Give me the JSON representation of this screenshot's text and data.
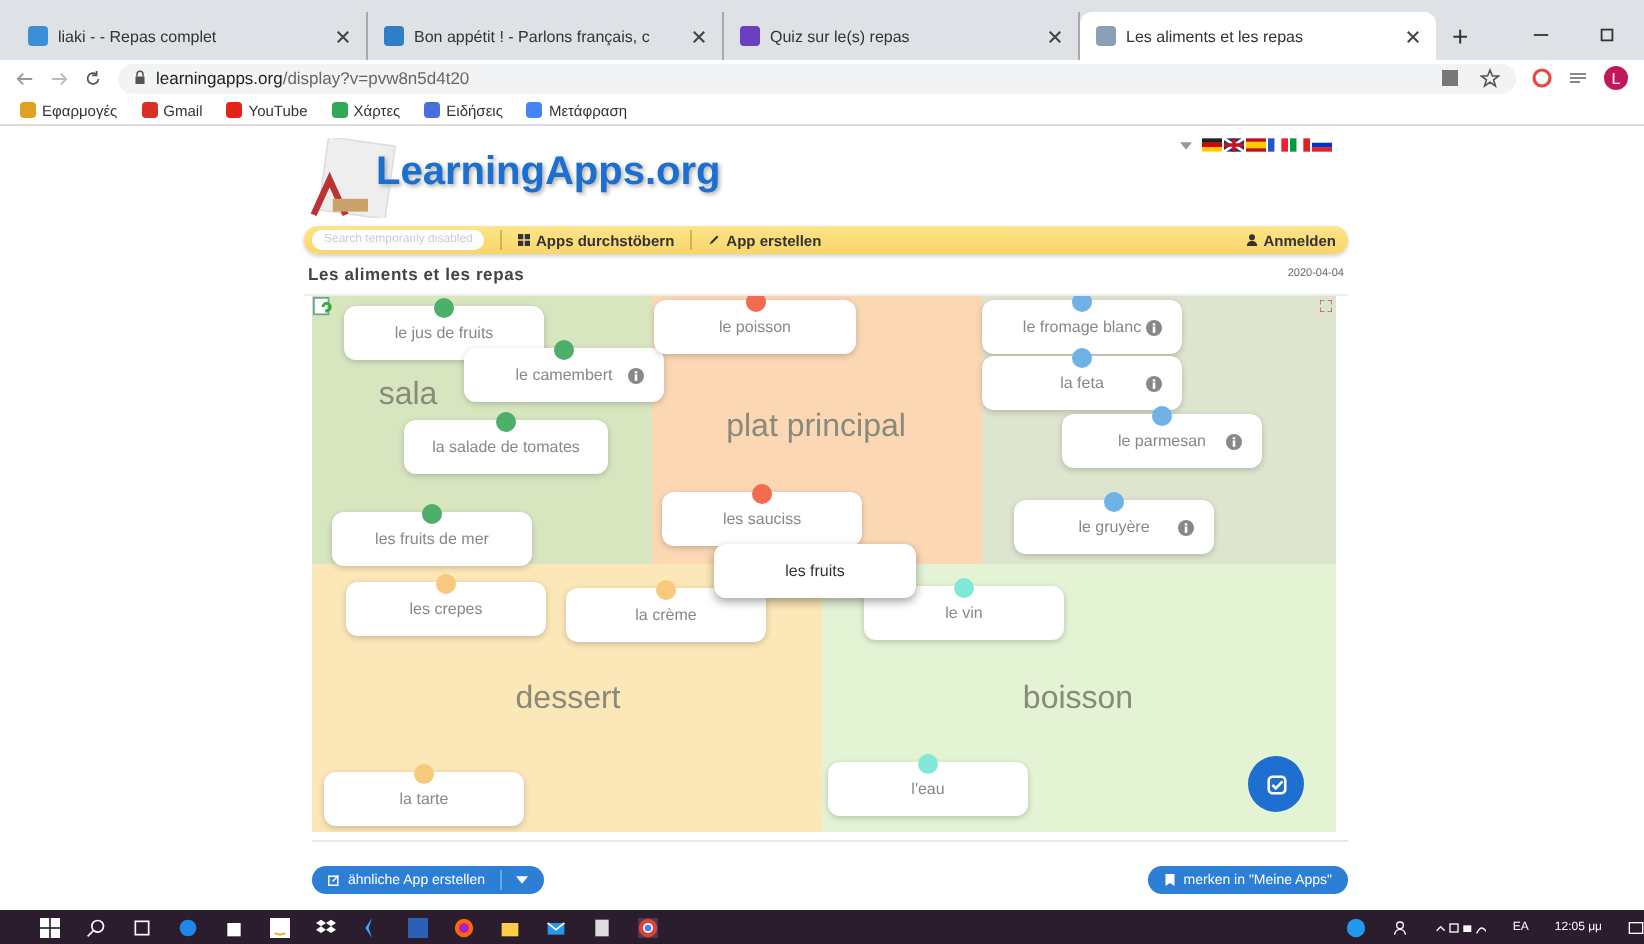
{
  "browser": {
    "tabs": [
      {
        "title": "liaki - - Repas complet",
        "selected": false,
        "color": "#3b8fd6"
      },
      {
        "title": "Bon appétit ! - Parlons français, c",
        "selected": false,
        "color": "#2f7fc8"
      },
      {
        "title": "Quiz sur le(s) repas",
        "selected": false,
        "color": "#6a3fbf"
      },
      {
        "title": "Les aliments et les repas",
        "selected": true,
        "color": "#8aa0b8"
      }
    ],
    "new_tab": "+",
    "url_host": "learningapps.org",
    "url_path": "/display?v=pvw8n5d4t20",
    "bookmarks": [
      {
        "label": "Εφαρμογές",
        "color": "#e0a020"
      },
      {
        "label": "Gmail",
        "color": "#d93025"
      },
      {
        "label": "YouTube",
        "color": "#e62117"
      },
      {
        "label": "Χάρτες",
        "color": "#34a853"
      },
      {
        "label": "Ειδήσεις",
        "color": "#4a6fd8"
      },
      {
        "label": "Μετάφραση",
        "color": "#4285f4"
      }
    ],
    "avatar": "L"
  },
  "site": {
    "logo": "LearningApps.org",
    "search": {
      "placeholder": "Search temporarily disabled"
    },
    "nav": [
      "Apps durchstöbern",
      "App erstellen"
    ],
    "login": "Anmelden"
  },
  "app": {
    "title": "Les aliments et les repas",
    "date": "2020-04-04",
    "zones": [
      {
        "label": "sala",
        "color": "#d8e6c0"
      },
      {
        "label": "plat principal",
        "color": "#fbd7b4"
      },
      {
        "color": "#dde5cf"
      },
      {
        "label": "dessert",
        "color": "#fce7b8"
      },
      {
        "label": "boisson",
        "color": "#e3f3d4"
      }
    ],
    "cards": [
      {
        "text": "le jus de fruits",
        "color": "#4caf6a",
        "info": false
      },
      {
        "text": "le camembert",
        "color": "#4caf6a",
        "info": true
      },
      {
        "text": "la salade de tomates",
        "color": "#4caf6a",
        "info": false
      },
      {
        "text": "les fruits de mer",
        "color": "#4caf6a",
        "info": false
      },
      {
        "text": "le poisson",
        "color": "#f26a4f",
        "info": false
      },
      {
        "text": "les sauciss",
        "color": "#f26a4f",
        "info": false
      },
      {
        "text": "le fromage blanc",
        "color": "#6fb3e6",
        "info": true
      },
      {
        "text": "la feta",
        "color": "#6fb3e6",
        "info": true
      },
      {
        "text": "le parmesan",
        "color": "#6fb3e6",
        "info": true
      },
      {
        "text": "le gruyère",
        "color": "#6fb3e6",
        "info": true
      },
      {
        "text": "les crepes",
        "color": "#f7c97a",
        "info": false
      },
      {
        "text": "la crème",
        "color": "#f7c97a",
        "info": false
      },
      {
        "text": "le vin",
        "color": "#7fe8d6",
        "info": false
      },
      {
        "text": "la tarte",
        "color": "#f7c97a",
        "info": false
      },
      {
        "text": "l'eau",
        "color": "#7fe8d6",
        "info": false
      }
    ],
    "dragged": {
      "text": "les fruits"
    }
  },
  "footer": {
    "similar": "ähnliche App erstellen",
    "remember": "merken in \"Meine Apps\""
  },
  "taskbar": {
    "lang": "EA",
    "time": "12:05 μμ"
  }
}
